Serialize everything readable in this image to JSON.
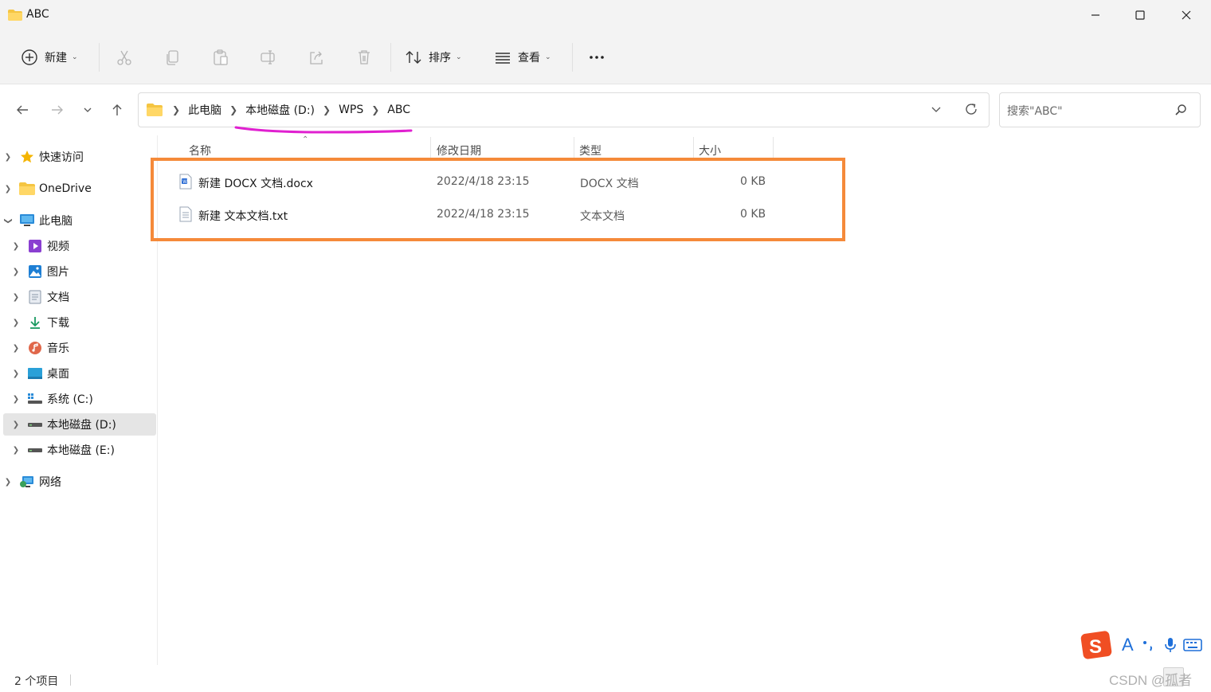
{
  "window": {
    "title": "ABC",
    "minimize_icon": "minimize-icon",
    "maximize_icon": "maximize-icon",
    "close_icon": "close-icon"
  },
  "toolbar": {
    "new_label": "新建",
    "sort_label": "排序",
    "view_label": "查看",
    "icons": [
      "plus-circle-icon",
      "cut-icon",
      "copy-icon",
      "paste-icon",
      "rename-icon",
      "share-icon",
      "delete-icon",
      "sort-icon",
      "view-icon",
      "more-icon"
    ]
  },
  "nav": {
    "breadcrumb": [
      "此电脑",
      "本地磁盘 (D:)",
      "WPS",
      "ABC"
    ],
    "search_placeholder": "搜索\"ABC\""
  },
  "sidebar": {
    "items": [
      {
        "label": "快速访问",
        "icon": "star-icon"
      },
      {
        "label": "OneDrive",
        "icon": "folder-icon"
      },
      {
        "label": "此电脑",
        "icon": "computer-icon"
      },
      {
        "label": "视频",
        "icon": "video-icon"
      },
      {
        "label": "图片",
        "icon": "pictures-icon"
      },
      {
        "label": "文档",
        "icon": "documents-icon"
      },
      {
        "label": "下载",
        "icon": "download-icon"
      },
      {
        "label": "音乐",
        "icon": "music-icon"
      },
      {
        "label": "桌面",
        "icon": "desktop-icon"
      },
      {
        "label": "系统 (C:)",
        "icon": "drive-c-icon"
      },
      {
        "label": "本地磁盘 (D:)",
        "icon": "drive-icon",
        "selected": true
      },
      {
        "label": "本地磁盘 (E:)",
        "icon": "drive-icon"
      },
      {
        "label": "网络",
        "icon": "network-icon"
      }
    ]
  },
  "file_list": {
    "columns": [
      "名称",
      "修改日期",
      "类型",
      "大小"
    ],
    "rows": [
      {
        "name": "新建 DOCX 文档.docx",
        "modified": "2022/4/18 23:15",
        "type": "DOCX 文档",
        "size": "0 KB",
        "icon": "word-doc-icon"
      },
      {
        "name": "新建 文本文档.txt",
        "modified": "2022/4/18 23:15",
        "type": "文本文档",
        "size": "0 KB",
        "icon": "text-file-icon"
      }
    ]
  },
  "status": {
    "item_count": "2 个项目"
  },
  "overlay": {
    "ime_letter": "A",
    "watermark": "CSDN @孤者"
  },
  "colors": {
    "highlight_box": "#f58a3a",
    "annotation_underline": "#e020d0",
    "selected_bg": "#e5e5e5",
    "folder_yellow": "#f5c542"
  }
}
